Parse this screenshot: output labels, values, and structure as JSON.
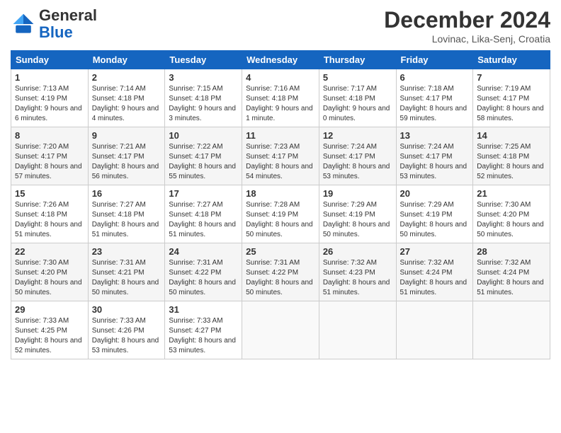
{
  "header": {
    "logo_line1": "General",
    "logo_line2": "Blue",
    "month": "December 2024",
    "location": "Lovinac, Lika-Senj, Croatia"
  },
  "days_of_week": [
    "Sunday",
    "Monday",
    "Tuesday",
    "Wednesday",
    "Thursday",
    "Friday",
    "Saturday"
  ],
  "weeks": [
    [
      {
        "num": "1",
        "sunrise": "Sunrise: 7:13 AM",
        "sunset": "Sunset: 4:19 PM",
        "daylight": "Daylight: 9 hours and 6 minutes."
      },
      {
        "num": "2",
        "sunrise": "Sunrise: 7:14 AM",
        "sunset": "Sunset: 4:18 PM",
        "daylight": "Daylight: 9 hours and 4 minutes."
      },
      {
        "num": "3",
        "sunrise": "Sunrise: 7:15 AM",
        "sunset": "Sunset: 4:18 PM",
        "daylight": "Daylight: 9 hours and 3 minutes."
      },
      {
        "num": "4",
        "sunrise": "Sunrise: 7:16 AM",
        "sunset": "Sunset: 4:18 PM",
        "daylight": "Daylight: 9 hours and 1 minute."
      },
      {
        "num": "5",
        "sunrise": "Sunrise: 7:17 AM",
        "sunset": "Sunset: 4:18 PM",
        "daylight": "Daylight: 9 hours and 0 minutes."
      },
      {
        "num": "6",
        "sunrise": "Sunrise: 7:18 AM",
        "sunset": "Sunset: 4:17 PM",
        "daylight": "Daylight: 8 hours and 59 minutes."
      },
      {
        "num": "7",
        "sunrise": "Sunrise: 7:19 AM",
        "sunset": "Sunset: 4:17 PM",
        "daylight": "Daylight: 8 hours and 58 minutes."
      }
    ],
    [
      {
        "num": "8",
        "sunrise": "Sunrise: 7:20 AM",
        "sunset": "Sunset: 4:17 PM",
        "daylight": "Daylight: 8 hours and 57 minutes."
      },
      {
        "num": "9",
        "sunrise": "Sunrise: 7:21 AM",
        "sunset": "Sunset: 4:17 PM",
        "daylight": "Daylight: 8 hours and 56 minutes."
      },
      {
        "num": "10",
        "sunrise": "Sunrise: 7:22 AM",
        "sunset": "Sunset: 4:17 PM",
        "daylight": "Daylight: 8 hours and 55 minutes."
      },
      {
        "num": "11",
        "sunrise": "Sunrise: 7:23 AM",
        "sunset": "Sunset: 4:17 PM",
        "daylight": "Daylight: 8 hours and 54 minutes."
      },
      {
        "num": "12",
        "sunrise": "Sunrise: 7:24 AM",
        "sunset": "Sunset: 4:17 PM",
        "daylight": "Daylight: 8 hours and 53 minutes."
      },
      {
        "num": "13",
        "sunrise": "Sunrise: 7:24 AM",
        "sunset": "Sunset: 4:17 PM",
        "daylight": "Daylight: 8 hours and 53 minutes."
      },
      {
        "num": "14",
        "sunrise": "Sunrise: 7:25 AM",
        "sunset": "Sunset: 4:18 PM",
        "daylight": "Daylight: 8 hours and 52 minutes."
      }
    ],
    [
      {
        "num": "15",
        "sunrise": "Sunrise: 7:26 AM",
        "sunset": "Sunset: 4:18 PM",
        "daylight": "Daylight: 8 hours and 51 minutes."
      },
      {
        "num": "16",
        "sunrise": "Sunrise: 7:27 AM",
        "sunset": "Sunset: 4:18 PM",
        "daylight": "Daylight: 8 hours and 51 minutes."
      },
      {
        "num": "17",
        "sunrise": "Sunrise: 7:27 AM",
        "sunset": "Sunset: 4:18 PM",
        "daylight": "Daylight: 8 hours and 51 minutes."
      },
      {
        "num": "18",
        "sunrise": "Sunrise: 7:28 AM",
        "sunset": "Sunset: 4:19 PM",
        "daylight": "Daylight: 8 hours and 50 minutes."
      },
      {
        "num": "19",
        "sunrise": "Sunrise: 7:29 AM",
        "sunset": "Sunset: 4:19 PM",
        "daylight": "Daylight: 8 hours and 50 minutes."
      },
      {
        "num": "20",
        "sunrise": "Sunrise: 7:29 AM",
        "sunset": "Sunset: 4:19 PM",
        "daylight": "Daylight: 8 hours and 50 minutes."
      },
      {
        "num": "21",
        "sunrise": "Sunrise: 7:30 AM",
        "sunset": "Sunset: 4:20 PM",
        "daylight": "Daylight: 8 hours and 50 minutes."
      }
    ],
    [
      {
        "num": "22",
        "sunrise": "Sunrise: 7:30 AM",
        "sunset": "Sunset: 4:20 PM",
        "daylight": "Daylight: 8 hours and 50 minutes."
      },
      {
        "num": "23",
        "sunrise": "Sunrise: 7:31 AM",
        "sunset": "Sunset: 4:21 PM",
        "daylight": "Daylight: 8 hours and 50 minutes."
      },
      {
        "num": "24",
        "sunrise": "Sunrise: 7:31 AM",
        "sunset": "Sunset: 4:22 PM",
        "daylight": "Daylight: 8 hours and 50 minutes."
      },
      {
        "num": "25",
        "sunrise": "Sunrise: 7:31 AM",
        "sunset": "Sunset: 4:22 PM",
        "daylight": "Daylight: 8 hours and 50 minutes."
      },
      {
        "num": "26",
        "sunrise": "Sunrise: 7:32 AM",
        "sunset": "Sunset: 4:23 PM",
        "daylight": "Daylight: 8 hours and 51 minutes."
      },
      {
        "num": "27",
        "sunrise": "Sunrise: 7:32 AM",
        "sunset": "Sunset: 4:24 PM",
        "daylight": "Daylight: 8 hours and 51 minutes."
      },
      {
        "num": "28",
        "sunrise": "Sunrise: 7:32 AM",
        "sunset": "Sunset: 4:24 PM",
        "daylight": "Daylight: 8 hours and 51 minutes."
      }
    ],
    [
      {
        "num": "29",
        "sunrise": "Sunrise: 7:33 AM",
        "sunset": "Sunset: 4:25 PM",
        "daylight": "Daylight: 8 hours and 52 minutes."
      },
      {
        "num": "30",
        "sunrise": "Sunrise: 7:33 AM",
        "sunset": "Sunset: 4:26 PM",
        "daylight": "Daylight: 8 hours and 53 minutes."
      },
      {
        "num": "31",
        "sunrise": "Sunrise: 7:33 AM",
        "sunset": "Sunset: 4:27 PM",
        "daylight": "Daylight: 8 hours and 53 minutes."
      },
      {
        "num": "",
        "sunrise": "",
        "sunset": "",
        "daylight": ""
      },
      {
        "num": "",
        "sunrise": "",
        "sunset": "",
        "daylight": ""
      },
      {
        "num": "",
        "sunrise": "",
        "sunset": "",
        "daylight": ""
      },
      {
        "num": "",
        "sunrise": "",
        "sunset": "",
        "daylight": ""
      }
    ]
  ]
}
